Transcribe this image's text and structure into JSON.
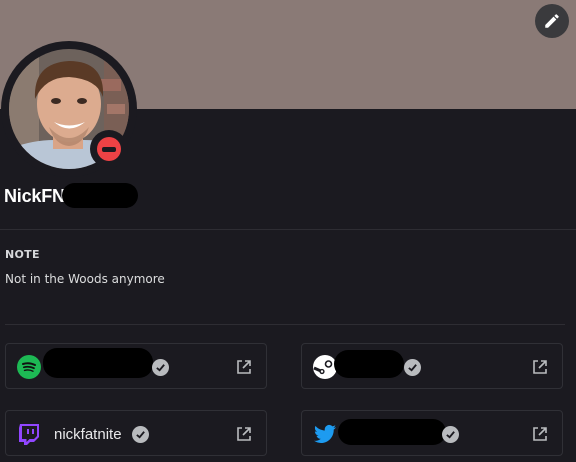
{
  "colors": {
    "banner": "#8a7a76",
    "page_background": "#1b1a20",
    "status_dnd": "#ed4245",
    "spotify": "#1db954",
    "twitch": "#9146ff",
    "twitter": "#1d9bf0"
  },
  "header": {
    "edit_icon": "pencil-icon",
    "avatar": "profile-photo",
    "status": "do-not-disturb"
  },
  "profile": {
    "username_visible": "NickFN"
  },
  "note": {
    "title": "NOTE",
    "text": "Not in the Woods anymore"
  },
  "connections": [
    {
      "service": "spotify",
      "icon": "spotify-icon",
      "name": ""
    },
    {
      "service": "steam",
      "icon": "steam-icon",
      "name": ""
    },
    {
      "service": "twitch",
      "icon": "twitch-icon",
      "name": "nickfatnite"
    },
    {
      "service": "twitter",
      "icon": "twitter-icon",
      "name": ""
    }
  ]
}
